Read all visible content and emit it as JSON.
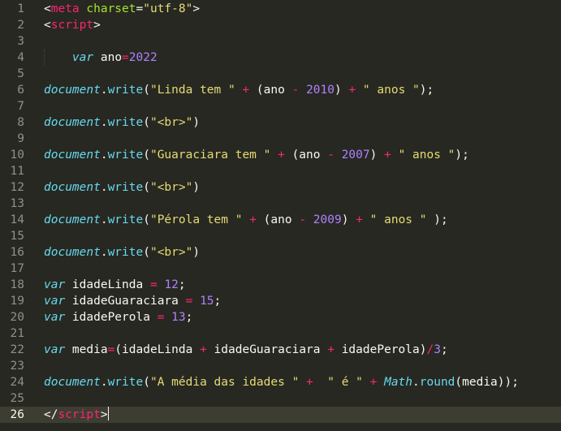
{
  "editor": {
    "theme_colors": {
      "background": "#272822",
      "gutter_text": "#8F908A",
      "current_line": "#3E3D32",
      "default": "#F8F8F2",
      "keyword": "#F92672",
      "attribute": "#A6E22E",
      "string": "#E6DB74",
      "storage": "#66D9EF",
      "number": "#AE81FF"
    },
    "current_line": 26,
    "lines": [
      {
        "n": "1",
        "tokens": [
          [
            "<",
            "d"
          ],
          [
            "meta",
            "k"
          ],
          [
            " ",
            "d"
          ],
          [
            "charset",
            "a"
          ],
          [
            "=",
            "d"
          ],
          [
            "\"utf-8\"",
            "s"
          ],
          [
            ">",
            "d"
          ]
        ]
      },
      {
        "n": "2",
        "tokens": [
          [
            "<",
            "d"
          ],
          [
            "script",
            "k"
          ],
          [
            ">",
            "d"
          ]
        ]
      },
      {
        "n": "3",
        "tokens": []
      },
      {
        "n": "4",
        "tokens": [
          [
            "    ",
            "d"
          ],
          [
            "var",
            "v"
          ],
          [
            " ano",
            "d"
          ],
          [
            "=",
            "k"
          ],
          [
            "2022",
            "n"
          ]
        ],
        "guide": true
      },
      {
        "n": "5",
        "tokens": []
      },
      {
        "n": "6",
        "tokens": [
          [
            "document",
            "v"
          ],
          [
            ".",
            "d"
          ],
          [
            "write",
            "v"
          ],
          [
            "(",
            "d"
          ],
          [
            "\"Linda tem \"",
            "s"
          ],
          [
            " ",
            "d"
          ],
          [
            "+",
            "k"
          ],
          [
            " (ano ",
            "d"
          ],
          [
            "-",
            "k"
          ],
          [
            " ",
            "d"
          ],
          [
            "2010",
            "n"
          ],
          [
            ") ",
            "d"
          ],
          [
            "+",
            "k"
          ],
          [
            " ",
            "d"
          ],
          [
            "\" anos \"",
            "s"
          ],
          [
            ");",
            "d"
          ]
        ]
      },
      {
        "n": "7",
        "tokens": []
      },
      {
        "n": "8",
        "tokens": [
          [
            "document",
            "v"
          ],
          [
            ".",
            "d"
          ],
          [
            "write",
            "v"
          ],
          [
            "(",
            "d"
          ],
          [
            "\"<br>\"",
            "s"
          ],
          [
            ")",
            "d"
          ]
        ]
      },
      {
        "n": "9",
        "tokens": []
      },
      {
        "n": "10",
        "tokens": [
          [
            "document",
            "v"
          ],
          [
            ".",
            "d"
          ],
          [
            "write",
            "v"
          ],
          [
            "(",
            "d"
          ],
          [
            "\"Guaraciara tem \"",
            "s"
          ],
          [
            " ",
            "d"
          ],
          [
            "+",
            "k"
          ],
          [
            " (ano ",
            "d"
          ],
          [
            "-",
            "k"
          ],
          [
            " ",
            "d"
          ],
          [
            "2007",
            "n"
          ],
          [
            ") ",
            "d"
          ],
          [
            "+",
            "k"
          ],
          [
            " ",
            "d"
          ],
          [
            "\" anos \"",
            "s"
          ],
          [
            ");",
            "d"
          ]
        ]
      },
      {
        "n": "11",
        "tokens": []
      },
      {
        "n": "12",
        "tokens": [
          [
            "document",
            "v"
          ],
          [
            ".",
            "d"
          ],
          [
            "write",
            "v"
          ],
          [
            "(",
            "d"
          ],
          [
            "\"<br>\"",
            "s"
          ],
          [
            ")",
            "d"
          ]
        ]
      },
      {
        "n": "13",
        "tokens": []
      },
      {
        "n": "14",
        "tokens": [
          [
            "document",
            "v"
          ],
          [
            ".",
            "d"
          ],
          [
            "write",
            "v"
          ],
          [
            "(",
            "d"
          ],
          [
            "\"Pérola tem \"",
            "s"
          ],
          [
            " ",
            "d"
          ],
          [
            "+",
            "k"
          ],
          [
            " (ano ",
            "d"
          ],
          [
            "-",
            "k"
          ],
          [
            " ",
            "d"
          ],
          [
            "2009",
            "n"
          ],
          [
            ") ",
            "d"
          ],
          [
            "+",
            "k"
          ],
          [
            " ",
            "d"
          ],
          [
            "\" anos \"",
            "s"
          ],
          [
            " );",
            "d"
          ]
        ]
      },
      {
        "n": "15",
        "tokens": []
      },
      {
        "n": "16",
        "tokens": [
          [
            "document",
            "v"
          ],
          [
            ".",
            "d"
          ],
          [
            "write",
            "v"
          ],
          [
            "(",
            "d"
          ],
          [
            "\"<br>\"",
            "s"
          ],
          [
            ")",
            "d"
          ]
        ]
      },
      {
        "n": "17",
        "tokens": []
      },
      {
        "n": "18",
        "tokens": [
          [
            "var",
            "v"
          ],
          [
            " idadeLinda ",
            "d"
          ],
          [
            "=",
            "k"
          ],
          [
            " ",
            "d"
          ],
          [
            "12",
            "n"
          ],
          [
            ";",
            "d"
          ]
        ]
      },
      {
        "n": "19",
        "tokens": [
          [
            "var",
            "v"
          ],
          [
            " idadeGuaraciara ",
            "d"
          ],
          [
            "=",
            "k"
          ],
          [
            " ",
            "d"
          ],
          [
            "15",
            "n"
          ],
          [
            ";",
            "d"
          ]
        ]
      },
      {
        "n": "20",
        "tokens": [
          [
            "var",
            "v"
          ],
          [
            " idadePerola ",
            "d"
          ],
          [
            "=",
            "k"
          ],
          [
            " ",
            "d"
          ],
          [
            "13",
            "n"
          ],
          [
            ";",
            "d"
          ]
        ]
      },
      {
        "n": "21",
        "tokens": []
      },
      {
        "n": "22",
        "tokens": [
          [
            "var",
            "v"
          ],
          [
            " media",
            "d"
          ],
          [
            "=",
            "k"
          ],
          [
            "(idadeLinda ",
            "d"
          ],
          [
            "+",
            "k"
          ],
          [
            " idadeGuaraciara ",
            "d"
          ],
          [
            "+",
            "k"
          ],
          [
            " idadePerola)",
            "d"
          ],
          [
            "/",
            "k"
          ],
          [
            "3",
            "n"
          ],
          [
            ";",
            "d"
          ]
        ]
      },
      {
        "n": "23",
        "tokens": []
      },
      {
        "n": "24",
        "tokens": [
          [
            "document",
            "v"
          ],
          [
            ".",
            "d"
          ],
          [
            "write",
            "v"
          ],
          [
            "(",
            "d"
          ],
          [
            "\"A média das idades \"",
            "s"
          ],
          [
            " ",
            "d"
          ],
          [
            "+",
            "k"
          ],
          [
            "  ",
            "d"
          ],
          [
            "\" é \"",
            "s"
          ],
          [
            " ",
            "d"
          ],
          [
            "+",
            "k"
          ],
          [
            " ",
            "d"
          ],
          [
            "Math",
            "v"
          ],
          [
            ".",
            "d"
          ],
          [
            "round",
            "v"
          ],
          [
            "(media));",
            "d"
          ]
        ]
      },
      {
        "n": "25",
        "tokens": []
      },
      {
        "n": "26",
        "tokens": [
          [
            "</",
            "d"
          ],
          [
            "script",
            "k"
          ],
          [
            ">",
            "d"
          ]
        ],
        "cursor": true
      }
    ]
  }
}
